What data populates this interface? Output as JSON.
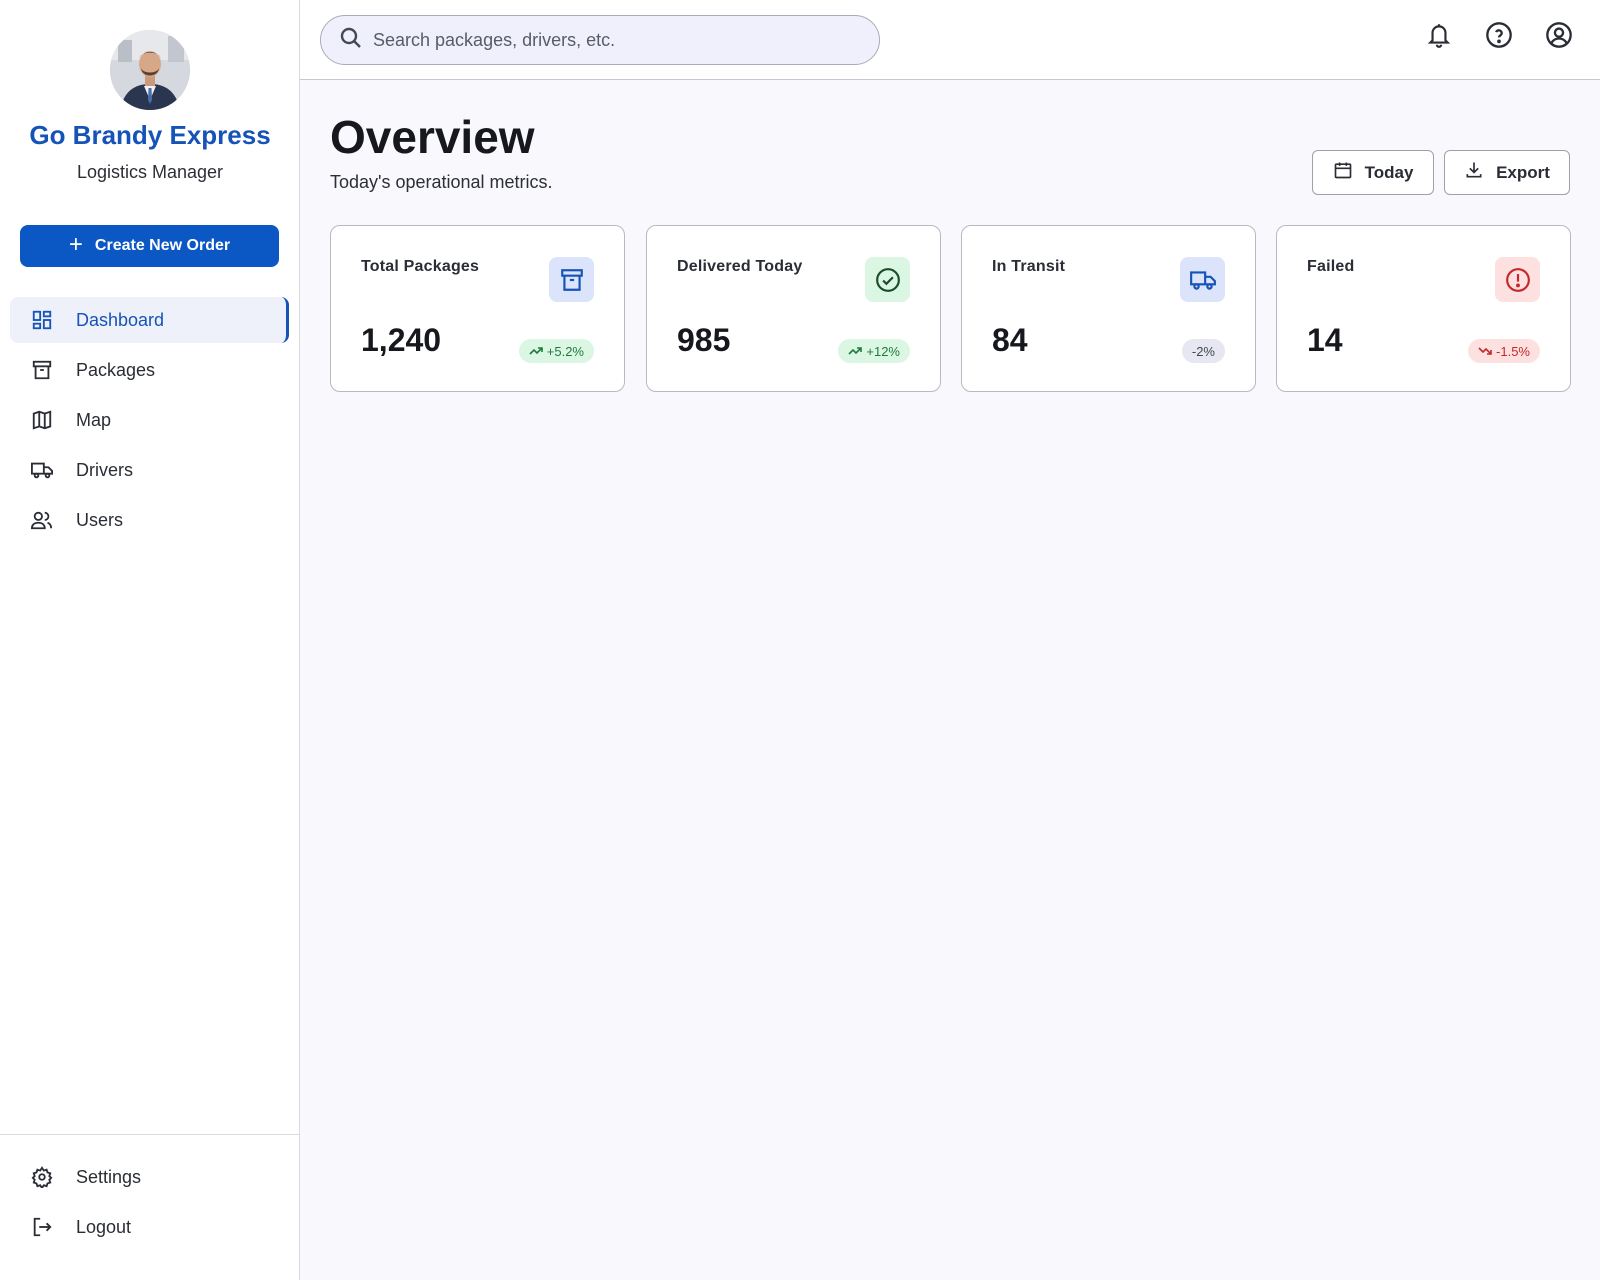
{
  "sidebar": {
    "brand_name": "Go Brandy Express",
    "brand_role": "Logistics Manager",
    "create_button": "Create New Order",
    "nav_items": [
      {
        "label": "Dashboard",
        "icon": "dashboard-icon",
        "active": true
      },
      {
        "label": "Packages",
        "icon": "archive-box-icon"
      },
      {
        "label": "Map",
        "icon": "map-icon"
      },
      {
        "label": "Drivers",
        "icon": "truck-icon"
      },
      {
        "label": "Users",
        "icon": "users-icon"
      }
    ],
    "bottom_items": [
      {
        "label": "Settings",
        "icon": "gear-icon"
      },
      {
        "label": "Logout",
        "icon": "logout-icon"
      }
    ]
  },
  "topbar": {
    "search_placeholder": "Search packages, drivers, etc.",
    "icons": [
      "bell-icon",
      "help-icon",
      "account-icon"
    ]
  },
  "header": {
    "title": "Overview",
    "subtitle": "Today's operational metrics.",
    "today_button": "Today",
    "export_button": "Export"
  },
  "cards": [
    {
      "title": "Total Packages",
      "value": "1,240",
      "change": "+5.2%",
      "trend": "up",
      "icon": "archive-box-icon"
    },
    {
      "title": "Delivered Today",
      "value": "985",
      "change": "+12%",
      "trend": "up",
      "icon": "check-circle-icon"
    },
    {
      "title": "In Transit",
      "value": "84",
      "change": "-2%",
      "trend": "neutral",
      "icon": "truck-icon"
    },
    {
      "title": "Failed",
      "value": "14",
      "change": "-1.5%",
      "trend": "down",
      "icon": "alert-circle-icon"
    }
  ],
  "colors": {
    "brand": "#1553b8",
    "primary_button": "#0b57c4",
    "success_bg": "#dcf6e4",
    "success_fg": "#1f7a3d",
    "danger_bg": "#fde0e0",
    "danger_fg": "#c62828",
    "neutral_bg": "#e6e7f0",
    "info_bg": "#dbe4fb"
  }
}
